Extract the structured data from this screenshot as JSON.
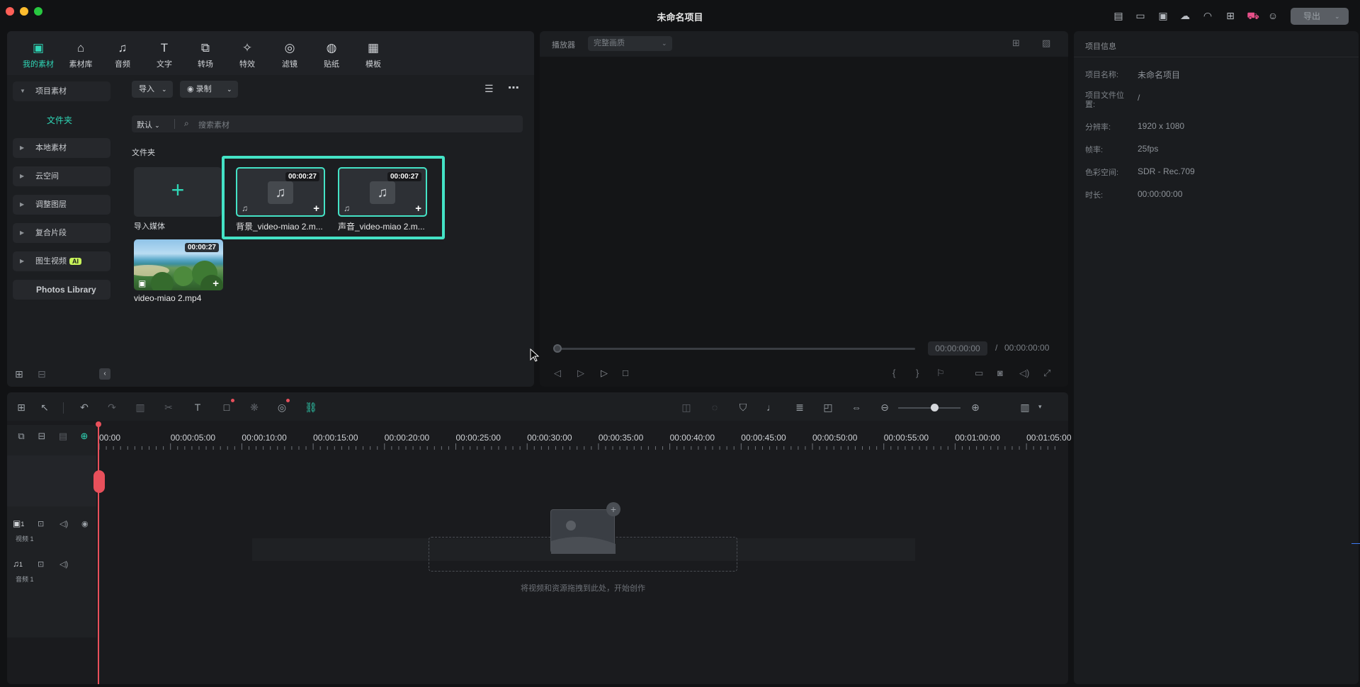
{
  "window": {
    "title": "未命名项目",
    "export_label": "导出"
  },
  "categories": [
    {
      "label": "我的素材",
      "icon": "folder-media-icon"
    },
    {
      "label": "素材库",
      "icon": "store-icon"
    },
    {
      "label": "音频",
      "icon": "music-note-icon"
    },
    {
      "label": "文字",
      "icon": "text-icon"
    },
    {
      "label": "转场",
      "icon": "transition-icon"
    },
    {
      "label": "特效",
      "icon": "effects-icon"
    },
    {
      "label": "滤镜",
      "icon": "filter-icon"
    },
    {
      "label": "贴纸",
      "icon": "sticker-icon"
    },
    {
      "label": "模板",
      "icon": "template-icon"
    }
  ],
  "sidebar": {
    "project_media": "项目素材",
    "folder": "文件夹",
    "items": [
      "本地素材",
      "云空间",
      "调整图层",
      "复合片段",
      "图生视频"
    ],
    "ai_badge": "AI",
    "photos_library": "Photos Library"
  },
  "media": {
    "import_label": "导入",
    "record_label": "录制",
    "sort_label": "默认",
    "search_placeholder": "搜索素材",
    "section_title": "文件夹",
    "import_media_label": "导入媒体",
    "items": [
      {
        "name": "背景_video-miao 2.m...",
        "duration": "00:00:27",
        "type": "audio"
      },
      {
        "name": "声音_video-miao 2.m...",
        "duration": "00:00:27",
        "type": "audio"
      },
      {
        "name": "video-miao 2.mp4",
        "duration": "00:00:27",
        "type": "video"
      }
    ]
  },
  "player": {
    "label": "播放器",
    "quality": "完整画质",
    "current_time": "00:00:00:00",
    "separator": "/",
    "total_time": "00:00:00:00"
  },
  "project_info": {
    "header": "项目信息",
    "rows": [
      {
        "label": "项目名称:",
        "value": "未命名项目"
      },
      {
        "label": "项目文件位置:",
        "value": "/"
      },
      {
        "label": "分辨率:",
        "value": "1920 x 1080"
      },
      {
        "label": "帧率:",
        "value": "25fps"
      },
      {
        "label": "色彩空间:",
        "value": "SDR - Rec.709"
      },
      {
        "label": "时长:",
        "value": "00:00:00:00"
      }
    ]
  },
  "timeline": {
    "ruler": [
      "00:00",
      "00:00:05:00",
      "00:00:10:00",
      "00:00:15:00",
      "00:00:20:00",
      "00:00:25:00",
      "00:00:30:00",
      "00:00:35:00",
      "00:00:40:00",
      "00:00:45:00",
      "00:00:50:00",
      "00:00:55:00",
      "00:01:00:00",
      "00:01:05:00"
    ],
    "tracks": [
      {
        "num": "1",
        "name": "视频 1"
      },
      {
        "num": "1",
        "name": "音频 1"
      }
    ],
    "drop_hint": "将视频和资源拖拽到此处，开始创作"
  },
  "colors": {
    "accent": "#2fd6b6",
    "playhead": "#e8505b"
  }
}
